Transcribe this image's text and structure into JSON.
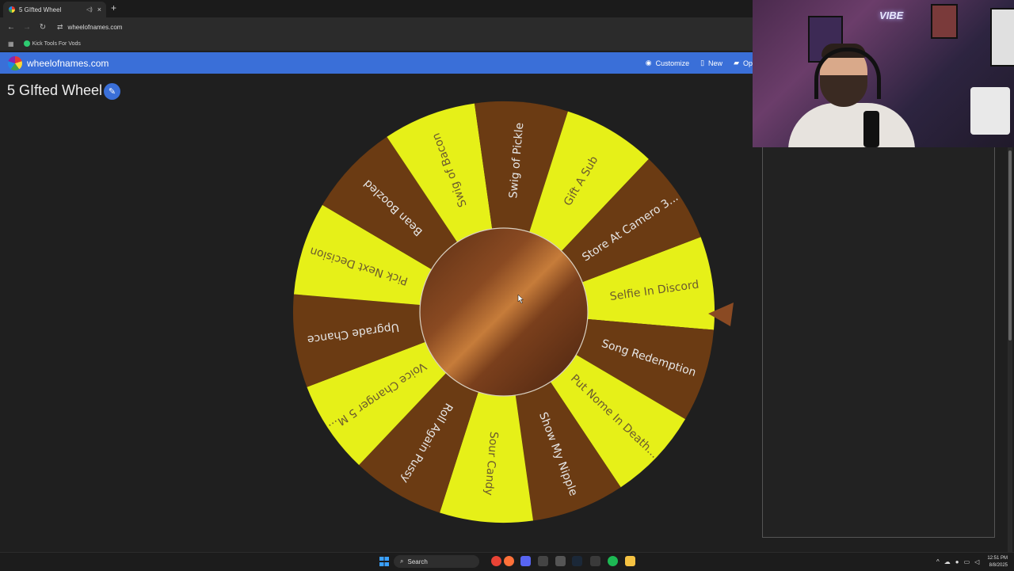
{
  "browser": {
    "tab_title": "5 GIfted Wheel",
    "url": "wheelofnames.com",
    "bookmark_label": "Kick Tools For Vods",
    "icons": {
      "back": "←",
      "forward": "→",
      "reload": "↻",
      "siteinfo": "⇄",
      "apps": "▦",
      "newtab": "+",
      "close": "×",
      "mute": "◁)"
    }
  },
  "app": {
    "site_name": "wheelofnames.com",
    "menu": {
      "customize": "Customize",
      "new": "New",
      "open": "Op"
    },
    "wheel_title": "5 GIfted Wheel",
    "edit_icon": "✎"
  },
  "wheel": {
    "colors": {
      "yellow": "#e6f018",
      "brown": "#6b3b13",
      "pointer": "#8a4a23",
      "text_on_dark": "#e6e6e6",
      "text_on_light": "#6b5a2e"
    },
    "segments": [
      {
        "label": "Selfie In Discord",
        "color": "yellow"
      },
      {
        "label": "Song Redemption",
        "color": "brown"
      },
      {
        "label": "Put Nome In Death...",
        "color": "yellow"
      },
      {
        "label": "Show My Nipple",
        "color": "brown"
      },
      {
        "label": "Sour Candy",
        "color": "yellow"
      },
      {
        "label": "Roll Again Pussy",
        "color": "brown"
      },
      {
        "label": "Voice Changer 5 M...",
        "color": "yellow"
      },
      {
        "label": "Upgrade Chance",
        "color": "brown"
      },
      {
        "label": "Pick Next Decision",
        "color": "yellow"
      },
      {
        "label": "Bean Boozled",
        "color": "brown"
      },
      {
        "label": "Swig of Bacon",
        "color": "yellow"
      },
      {
        "label": "Swig of Pickle",
        "color": "brown"
      },
      {
        "label": "Gift A Sub",
        "color": "yellow"
      },
      {
        "label": "Store At Camero 3...",
        "color": "brown"
      }
    ]
  },
  "webcam": {
    "neon_text": "VIBE"
  },
  "taskbar": {
    "search_placeholder": "Search",
    "time": "12:51 PM",
    "date": "8/8/2025"
  }
}
